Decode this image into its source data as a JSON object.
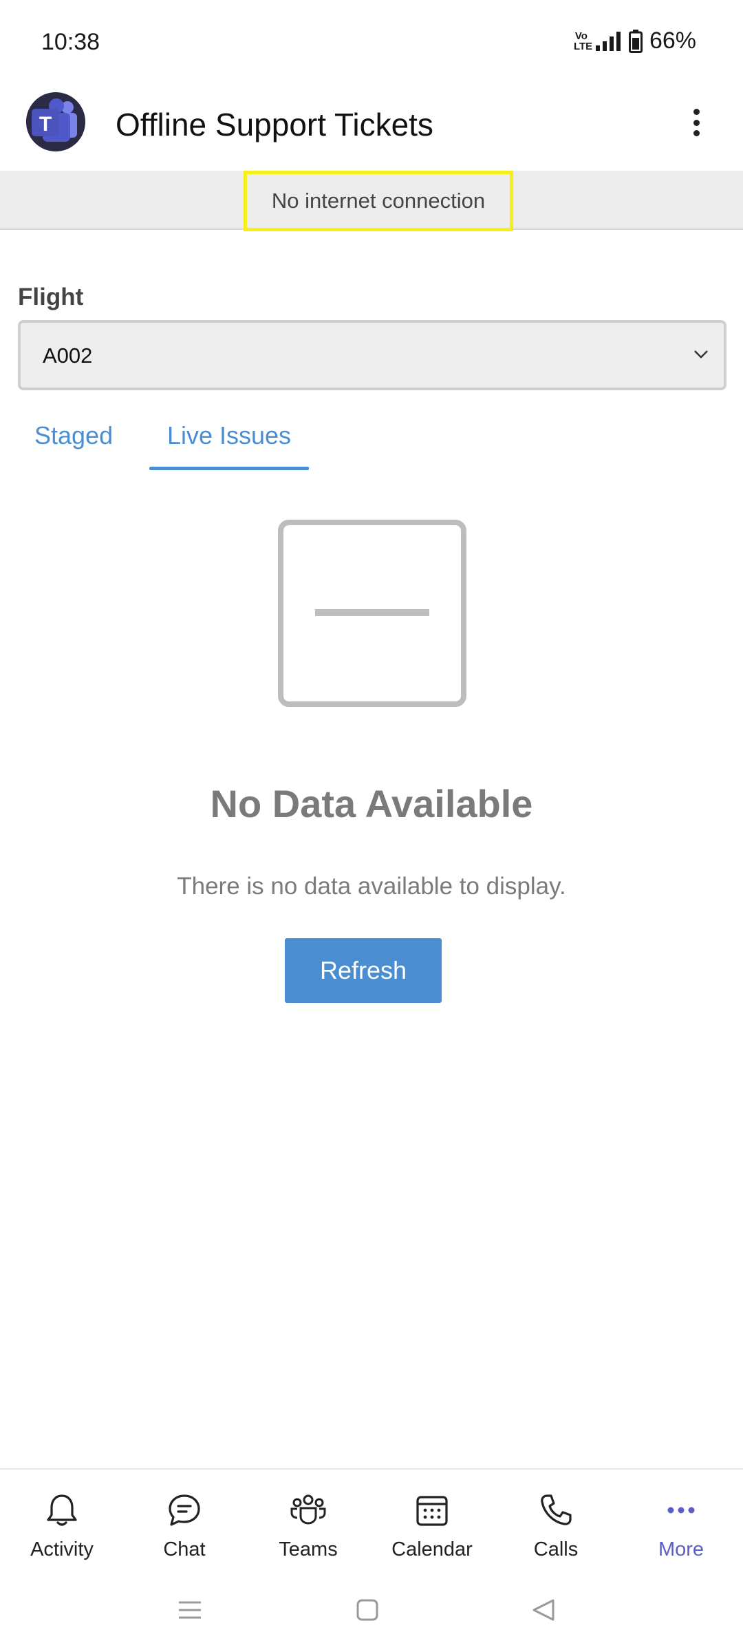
{
  "status_bar": {
    "time": "10:38",
    "network": "VoLTE",
    "battery": "66%"
  },
  "header": {
    "title": "Offline Support Tickets",
    "logo_letter": "T"
  },
  "banner": {
    "message": "No internet connection"
  },
  "flight": {
    "label": "Flight",
    "selected": "A002"
  },
  "tabs": [
    {
      "label": "Staged",
      "active": false
    },
    {
      "label": "Live Issues",
      "active": true
    }
  ],
  "empty_state": {
    "title": "No Data Available",
    "description": "There is no data available to display.",
    "button": "Refresh"
  },
  "bottom_nav": [
    {
      "label": "Activity",
      "icon": "bell-icon"
    },
    {
      "label": "Chat",
      "icon": "chat-icon"
    },
    {
      "label": "Teams",
      "icon": "teams-icon"
    },
    {
      "label": "Calendar",
      "icon": "calendar-icon"
    },
    {
      "label": "Calls",
      "icon": "phone-icon"
    },
    {
      "label": "More",
      "icon": "more-icon",
      "active": true
    }
  ],
  "colors": {
    "accent": "#4a8ed1",
    "teams_purple": "#5b5fc7",
    "highlight": "#f6ee17",
    "banner_bg": "#ececec"
  }
}
